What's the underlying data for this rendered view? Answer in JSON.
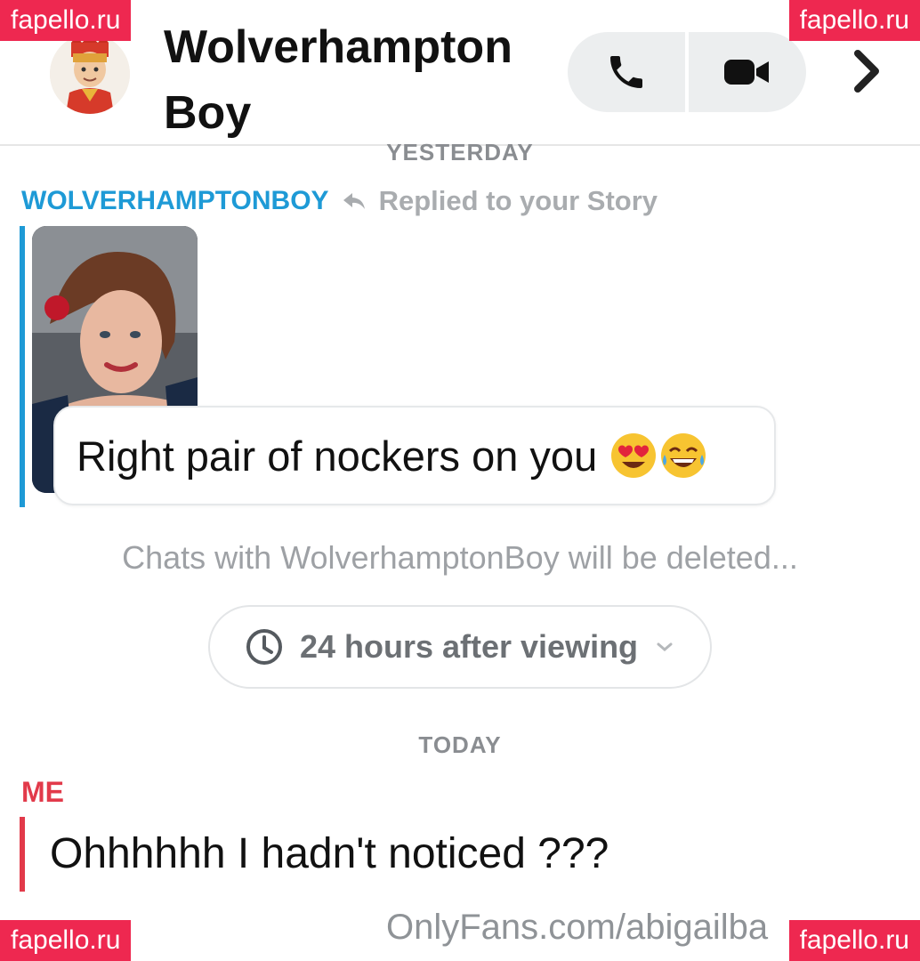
{
  "header": {
    "contact_name": "Wolverhampton Boy",
    "voice_call_icon": "phone-icon",
    "video_call_icon": "video-camera-icon",
    "more_icon": "chevron-right-icon"
  },
  "conversation": {
    "day_label_1": "YESTERDAY",
    "sender_name": "WOLVERHAMPTONBOY",
    "reply_icon": "reply-arrow-icon",
    "reply_note": "Replied to your Story",
    "message_1": "Right pair of nockers on you",
    "message_1_emojis": [
      "heart-eyes-emoji",
      "tears-of-joy-emoji"
    ],
    "delete_notice": "Chats with WolverhamptonBoy will be deleted...",
    "timer_label": "24 hours after viewing",
    "day_label_2": "TODAY",
    "me_label": "ME",
    "message_2": "Ohhhhhh I hadn't noticed ???"
  },
  "overlays": {
    "watermark": "fapello.ru",
    "footer_url": "OnlyFans.com/abigailba"
  },
  "colors": {
    "sender_blue": "#1e9ad6",
    "me_red": "#e23a4a",
    "watermark_pink": "#ee2850"
  }
}
